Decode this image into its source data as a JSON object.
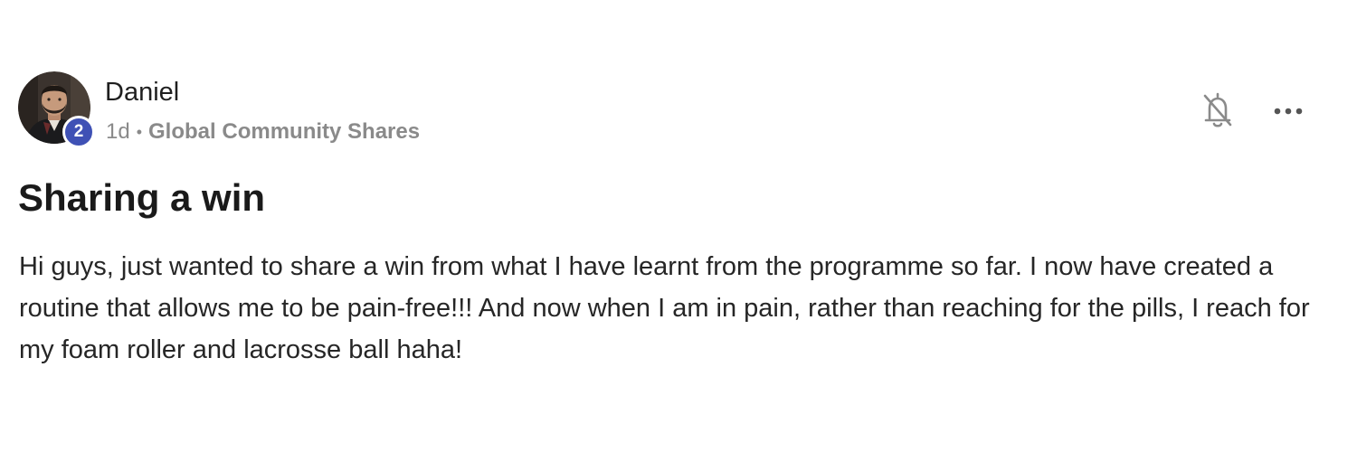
{
  "post": {
    "author": {
      "name": "Daniel",
      "level": "2"
    },
    "meta": {
      "time_ago": "1d",
      "separator": "•",
      "category": "Global Community Shares"
    },
    "title": "Sharing a win",
    "body": "Hi guys, just wanted to share a win from what I have learnt from the programme so far. I now have created a routine that allows me to be pain-free!!! And now when I am in pain, rather than reaching for the pills, I reach for my foam roller and lacrosse ball haha!",
    "actions": {
      "notifications_icon": "bell-off-icon",
      "more_icon": "more-horizontal-icon"
    }
  },
  "colors": {
    "badge": "#3f51b5",
    "meta_text": "#8a8a8a",
    "text": "#222222"
  }
}
